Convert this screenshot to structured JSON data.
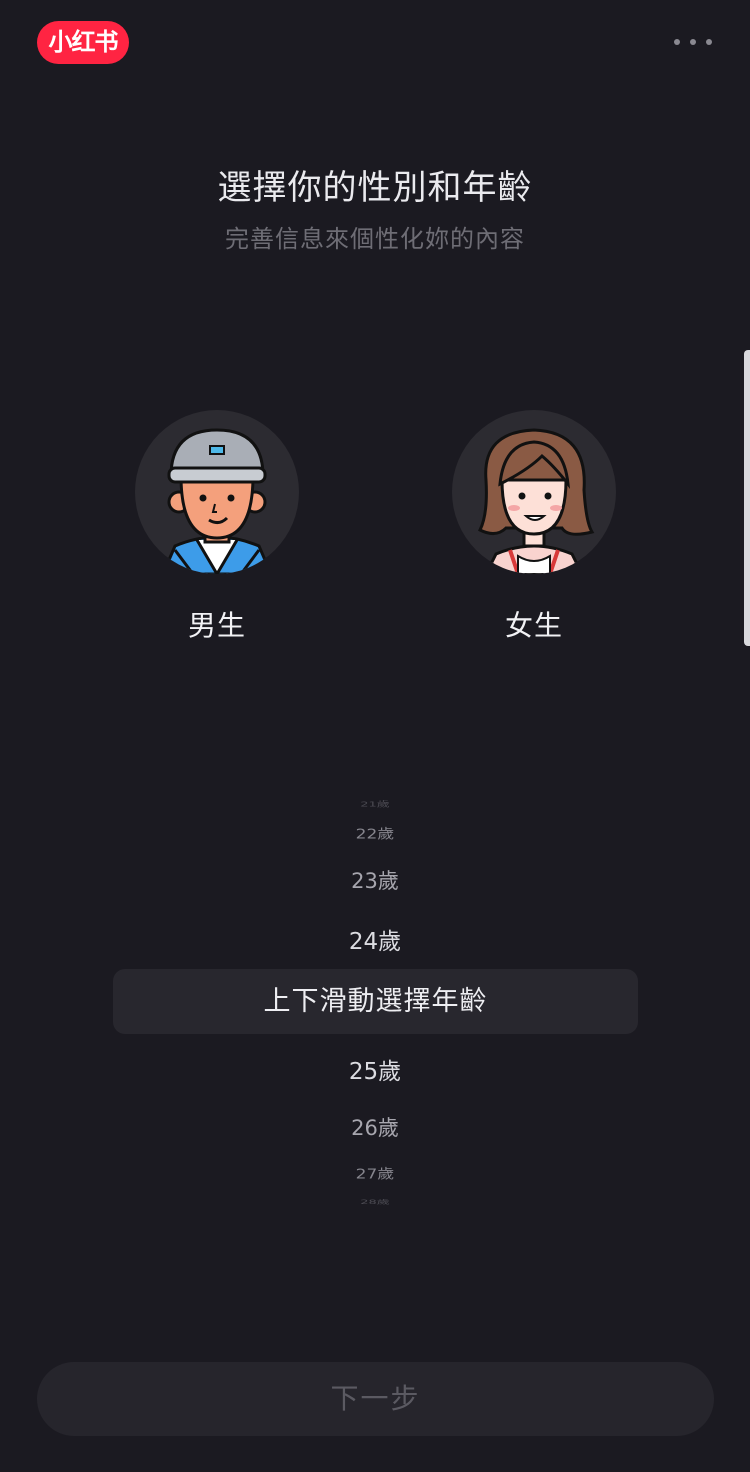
{
  "app": {
    "logo_text": "小红书"
  },
  "header": {
    "title": "選擇你的性別和年齡",
    "subtitle": "完善信息來個性化妳的內容"
  },
  "gender": {
    "male_label": "男生",
    "female_label": "女生"
  },
  "age_picker": {
    "prompt": "上下滑動選擇年齡",
    "above": [
      "21歲",
      "22歲",
      "23歲",
      "24歲"
    ],
    "below": [
      "25歲",
      "26歲",
      "27歲",
      "28歲"
    ]
  },
  "footer": {
    "next_label": "下一步"
  },
  "colors": {
    "brand": "#ff2442",
    "background": "#1b1a21",
    "button_bg": "#26252c"
  }
}
